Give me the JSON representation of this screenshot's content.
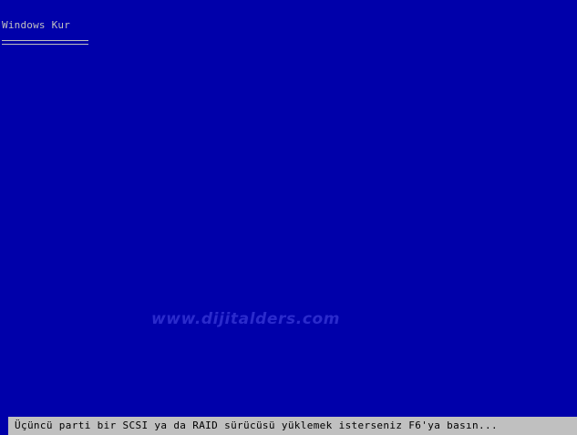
{
  "window": {
    "title": "Windows Kur"
  },
  "watermark": {
    "text": "www.dijitalders.com"
  },
  "status_bar": {
    "message": "Üçüncü parti bir SCSI ya da RAID sürücüsü yüklemek isterseniz F6'ya basın..."
  },
  "colors": {
    "background": "#0000aa",
    "text_light": "#c0c0c0",
    "status_bar": "#c0c0c0",
    "status_text": "#000000"
  }
}
